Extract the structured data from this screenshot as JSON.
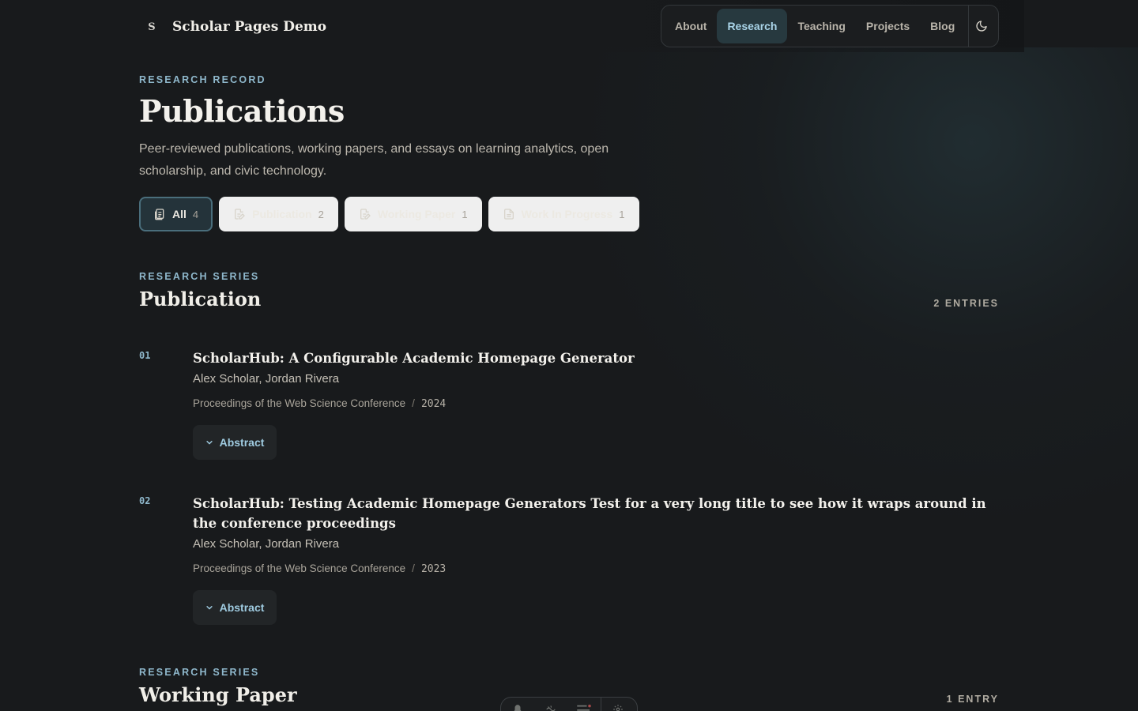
{
  "brand": {
    "mark": "S",
    "name": "Scholar Pages Demo"
  },
  "nav": {
    "items": [
      {
        "label": "About",
        "active": false
      },
      {
        "label": "Research",
        "active": true
      },
      {
        "label": "Teaching",
        "active": false
      },
      {
        "label": "Projects",
        "active": false
      },
      {
        "label": "Blog",
        "active": false
      }
    ],
    "theme_icon": "moon-icon"
  },
  "hero": {
    "eyebrow": "RESEARCH RECORD",
    "title": "Publications",
    "description": "Peer-reviewed publications, working papers, and essays on learning analytics, open scholarship, and civic technology."
  },
  "filters": [
    {
      "label": "All",
      "count": "4",
      "active": true,
      "icon": "documents-icon"
    },
    {
      "label": "Publication",
      "count": "2",
      "active": false,
      "icon": "document-edit-icon"
    },
    {
      "label": "Working Paper",
      "count": "1",
      "active": false,
      "icon": "document-edit-icon"
    },
    {
      "label": "Work In Progress",
      "count": "1",
      "active": false,
      "icon": "document-icon"
    }
  ],
  "series": [
    {
      "eyebrow": "RESEARCH SERIES",
      "title": "Publication",
      "entries_count": "2 ENTRIES",
      "entries": [
        {
          "num": "01",
          "title": "ScholarHub: A Configurable Academic Homepage Generator",
          "authors": "Alex Scholar, Jordan Rivera",
          "venue": "Proceedings of the Web Science Conference",
          "separator": "/",
          "year": "2024",
          "abstract_label": "Abstract"
        },
        {
          "num": "02",
          "title": "ScholarHub: Testing Academic Homepage Generators Test for a very long title to see how it wraps around in the conference proceedings",
          "authors": "Alex Scholar, Jordan Rivera",
          "venue": "Proceedings of the Web Science Conference",
          "separator": "/",
          "year": "2023",
          "abstract_label": "Abstract"
        }
      ]
    },
    {
      "eyebrow": "RESEARCH SERIES",
      "title": "Working Paper",
      "entries_count": "1 ENTRY"
    }
  ],
  "floating_toolbar": {
    "icons": [
      "bell-icon",
      "edit-icon",
      "menu-icon",
      "settings-icon"
    ]
  },
  "colors": {
    "background": "#181a1c",
    "accent": "#8fb8cc",
    "active_nav_bg": "#27393f"
  }
}
